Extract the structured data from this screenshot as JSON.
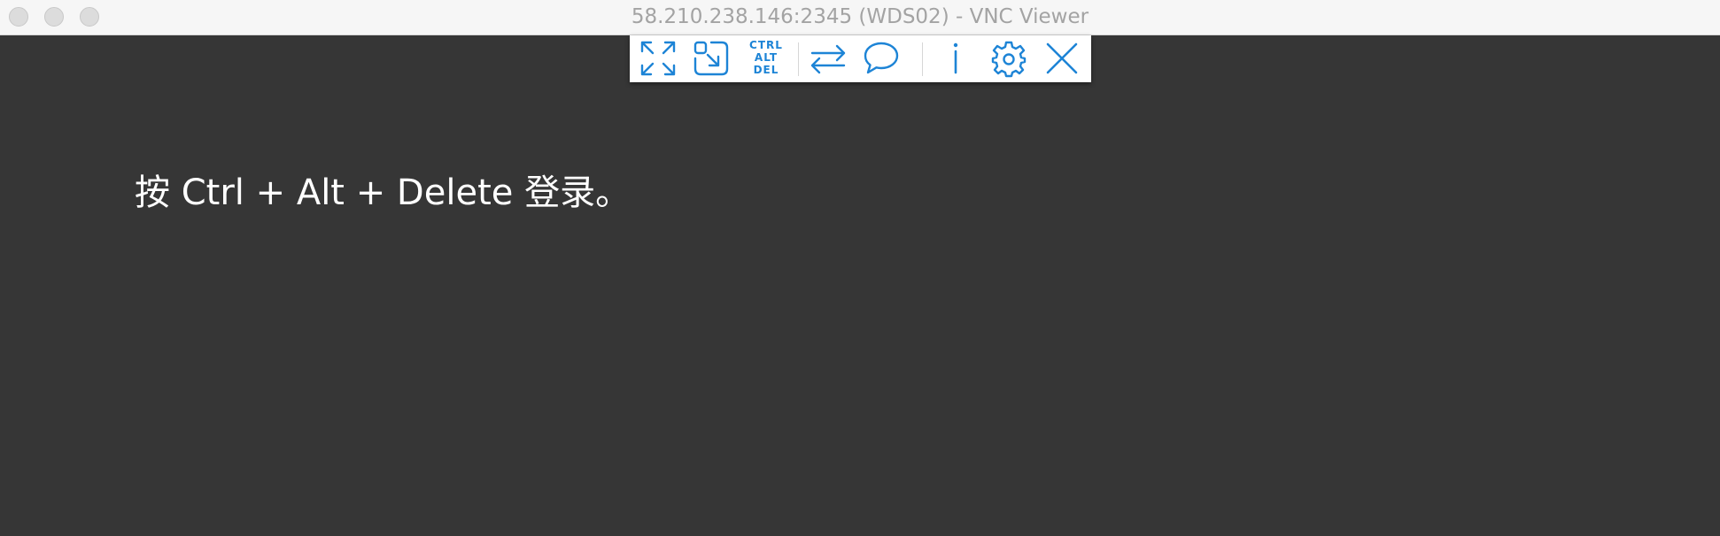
{
  "window": {
    "title": "58.210.238.146:2345 (WDS02) - VNC Viewer"
  },
  "toolbar": {
    "ctrl_alt_del": {
      "line1": "CTRL",
      "line2": "ALT",
      "line3": "DEL"
    },
    "icons": [
      "fullscreen-icon",
      "scale-icon",
      "ctrl-alt-del-icon",
      "transfer-icon",
      "chat-icon",
      "info-icon",
      "settings-icon",
      "close-icon"
    ],
    "accent_color": "#1d84d6"
  },
  "remote_screen": {
    "message": "按 Ctrl + Alt + Delete 登录。",
    "background": "#363636"
  }
}
